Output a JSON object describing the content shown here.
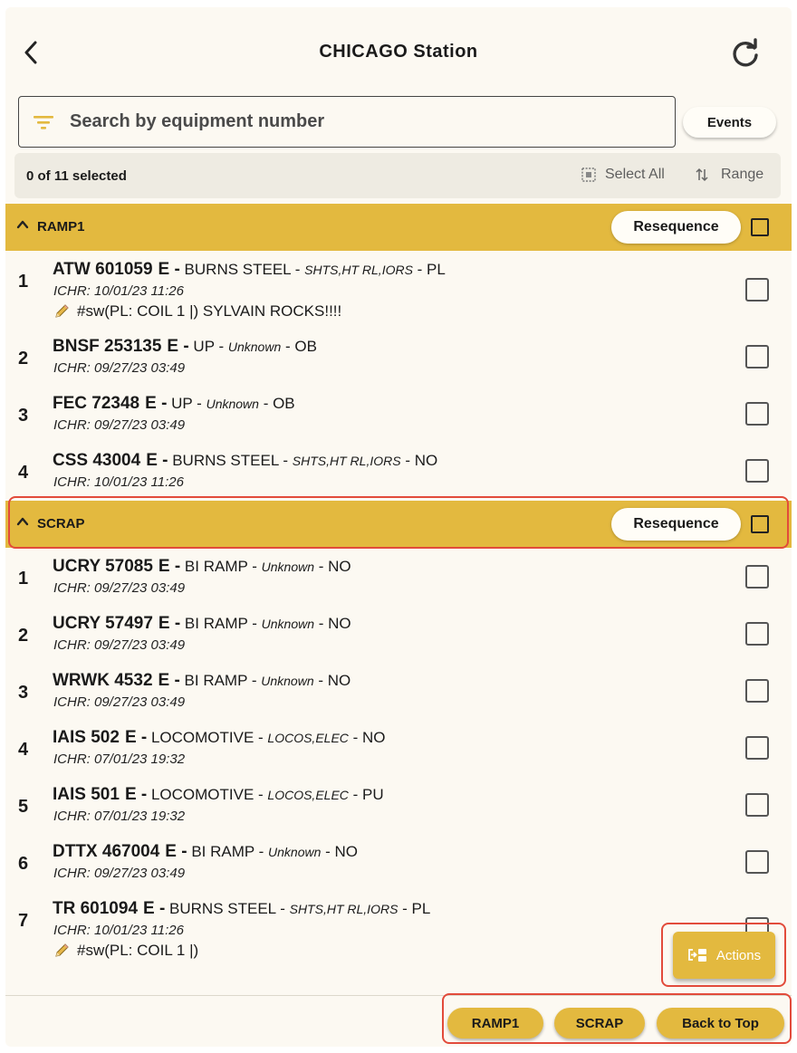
{
  "header": {
    "title": "CHICAGO Station"
  },
  "search": {
    "placeholder": "Search by equipment number",
    "value": ""
  },
  "events_label": "Events",
  "selection": {
    "count_text": "0 of 11 selected",
    "select_all_label": "Select All",
    "range_label": "Range"
  },
  "groups": [
    {
      "name": "RAMP1",
      "resequence_label": "Resequence",
      "rows": [
        {
          "num": "1",
          "equipment": "ATW 601059",
          "status": "E -",
          "location": "BURNS STEEL -",
          "commodity": "SHTS,HT RL,IORS",
          "dest": "- PL",
          "ichr": "ICHR: 10/01/23 11:26",
          "note": "#sw(PL: COIL 1 |) SYLVAIN ROCKS!!!!"
        },
        {
          "num": "2",
          "equipment": "BNSF 253135",
          "status": "E -",
          "location": "UP -",
          "commodity": "Unknown",
          "dest": "- OB",
          "ichr": "ICHR: 09/27/23 03:49"
        },
        {
          "num": "3",
          "equipment": "FEC 72348",
          "status": "E -",
          "location": "UP -",
          "commodity": "Unknown",
          "dest": "- OB",
          "ichr": "ICHR: 09/27/23 03:49"
        },
        {
          "num": "4",
          "equipment": "CSS 43004",
          "status": "E -",
          "location": "BURNS STEEL -",
          "commodity": "SHTS,HT RL,IORS",
          "dest": "- NO",
          "ichr": "ICHR: 10/01/23 11:26"
        }
      ]
    },
    {
      "name": "SCRAP",
      "resequence_label": "Resequence",
      "rows": [
        {
          "num": "1",
          "equipment": "UCRY 57085",
          "status": "E -",
          "location": "BI RAMP -",
          "commodity": "Unknown",
          "dest": "- NO",
          "ichr": "ICHR: 09/27/23 03:49"
        },
        {
          "num": "2",
          "equipment": "UCRY 57497",
          "status": "E -",
          "location": "BI RAMP -",
          "commodity": "Unknown",
          "dest": "- NO",
          "ichr": "ICHR: 09/27/23 03:49"
        },
        {
          "num": "3",
          "equipment": "WRWK 4532",
          "status": "E -",
          "location": "BI RAMP -",
          "commodity": "Unknown",
          "dest": "- NO",
          "ichr": "ICHR: 09/27/23 03:49"
        },
        {
          "num": "4",
          "equipment": "IAIS 502",
          "status": "E -",
          "location": "LOCOMOTIVE -",
          "commodity": "LOCOS,ELEC",
          "dest": "- NO",
          "ichr": "ICHR: 07/01/23 19:32"
        },
        {
          "num": "5",
          "equipment": "IAIS 501",
          "status": "E -",
          "location": "LOCOMOTIVE -",
          "commodity": "LOCOS,ELEC",
          "dest": "- PU",
          "ichr": "ICHR: 07/01/23 19:32"
        },
        {
          "num": "6",
          "equipment": "DTTX 467004",
          "status": "E -",
          "location": "BI RAMP -",
          "commodity": "Unknown",
          "dest": "- NO",
          "ichr": "ICHR: 09/27/23 03:49"
        },
        {
          "num": "7",
          "equipment": "TR 601094",
          "status": "E -",
          "location": "BURNS STEEL -",
          "commodity": "SHTS,HT RL,IORS",
          "dest": "- PL",
          "ichr": "ICHR: 10/01/23 11:26",
          "note": "#sw(PL: COIL 1 |)"
        }
      ]
    }
  ],
  "actions_label": "Actions",
  "footer": {
    "ramp1_label": "RAMP1",
    "scrap_label": "SCRAP",
    "back_to_top_label": "Back to Top"
  },
  "icons": {
    "back": "chevron-left-icon",
    "refresh": "refresh-icon",
    "filter": "filter-icon",
    "select_all": "select-all-icon",
    "range": "sort-arrows-icon",
    "collapse": "chevron-up-icon",
    "note": "pencil-icon",
    "actions": "actions-icon"
  },
  "colors": {
    "accent": "#e3b93f",
    "background": "#fcf9f2",
    "highlight": "#e24b3b"
  }
}
